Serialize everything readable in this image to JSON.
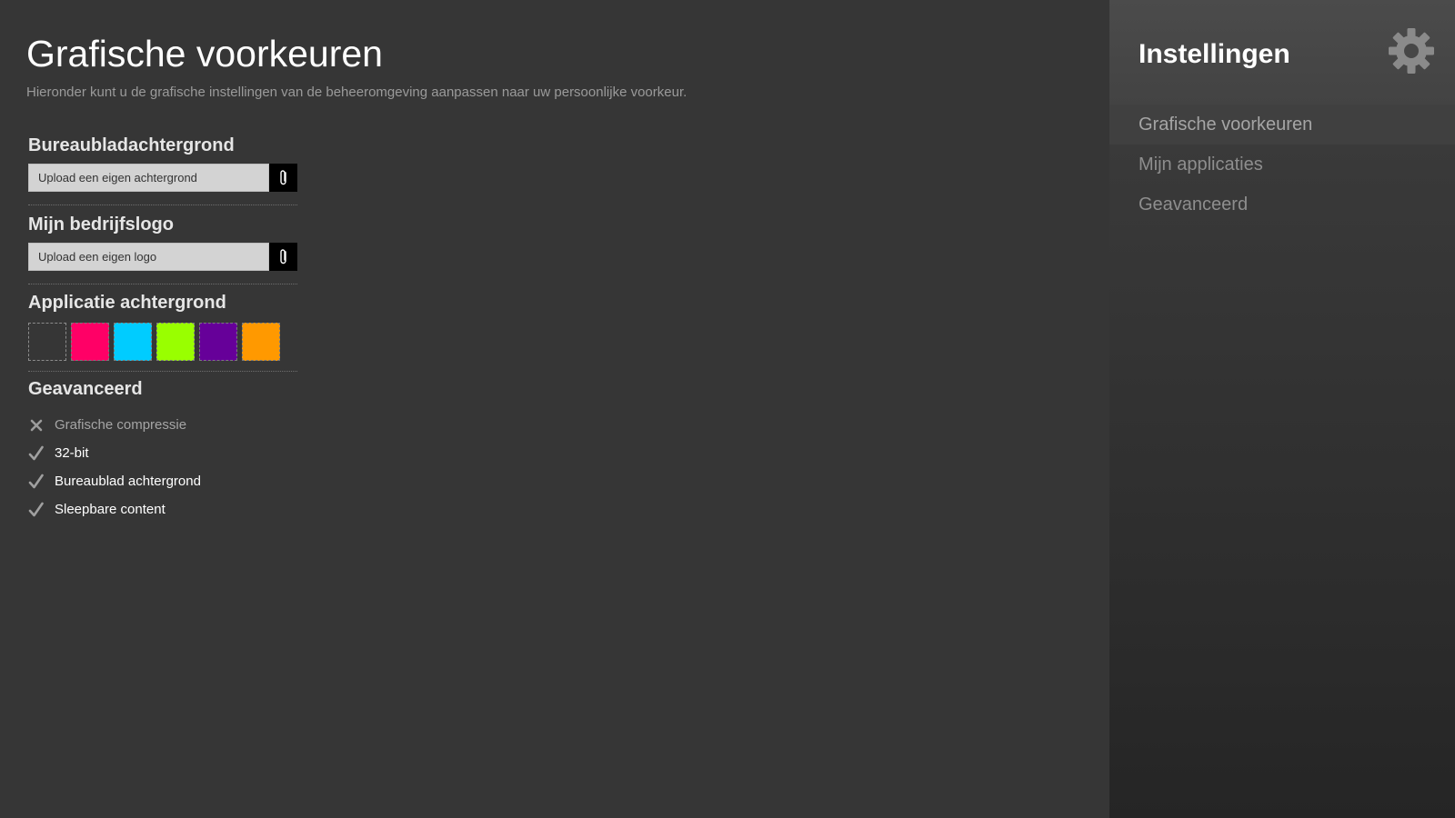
{
  "page": {
    "title": "Grafische voorkeuren",
    "subtitle": "Hieronder kunt u de grafische instellingen van de beheeromgeving aanpassen naar uw persoonlijke voorkeur."
  },
  "wallpaper": {
    "heading": "Bureaubladachtergrond",
    "placeholder": "Upload een eigen achtergrond",
    "button_icon": "paperclip-icon"
  },
  "logo": {
    "heading": "Mijn bedrijfslogo",
    "placeholder": "Upload een eigen logo",
    "button_icon": "paperclip-icon"
  },
  "app_background": {
    "heading": "Applicatie achtergrond",
    "swatches": [
      {
        "name": "transparent",
        "color": "transparent"
      },
      {
        "name": "pink",
        "color": "#ff0066"
      },
      {
        "name": "cyan",
        "color": "#00ccff"
      },
      {
        "name": "lime",
        "color": "#99ff00"
      },
      {
        "name": "purple",
        "color": "#660099"
      },
      {
        "name": "orange",
        "color": "#ff9900"
      }
    ]
  },
  "advanced": {
    "heading": "Geavanceerd",
    "options": [
      {
        "label": "Grafische compressie",
        "checked": false,
        "icon": "cross-icon"
      },
      {
        "label": "32-bit",
        "checked": true,
        "icon": "checkmark-icon"
      },
      {
        "label": "Bureaublad achtergrond",
        "checked": true,
        "icon": "checkmark-icon"
      },
      {
        "label": "Sleepbare content",
        "checked": true,
        "icon": "checkmark-icon"
      }
    ]
  },
  "sidebar": {
    "title": "Instellingen",
    "icon": "gear-icon",
    "items": [
      {
        "label": "Grafische voorkeuren",
        "active": true
      },
      {
        "label": "Mijn applicaties",
        "active": false
      },
      {
        "label": "Geavanceerd",
        "active": false
      }
    ]
  }
}
